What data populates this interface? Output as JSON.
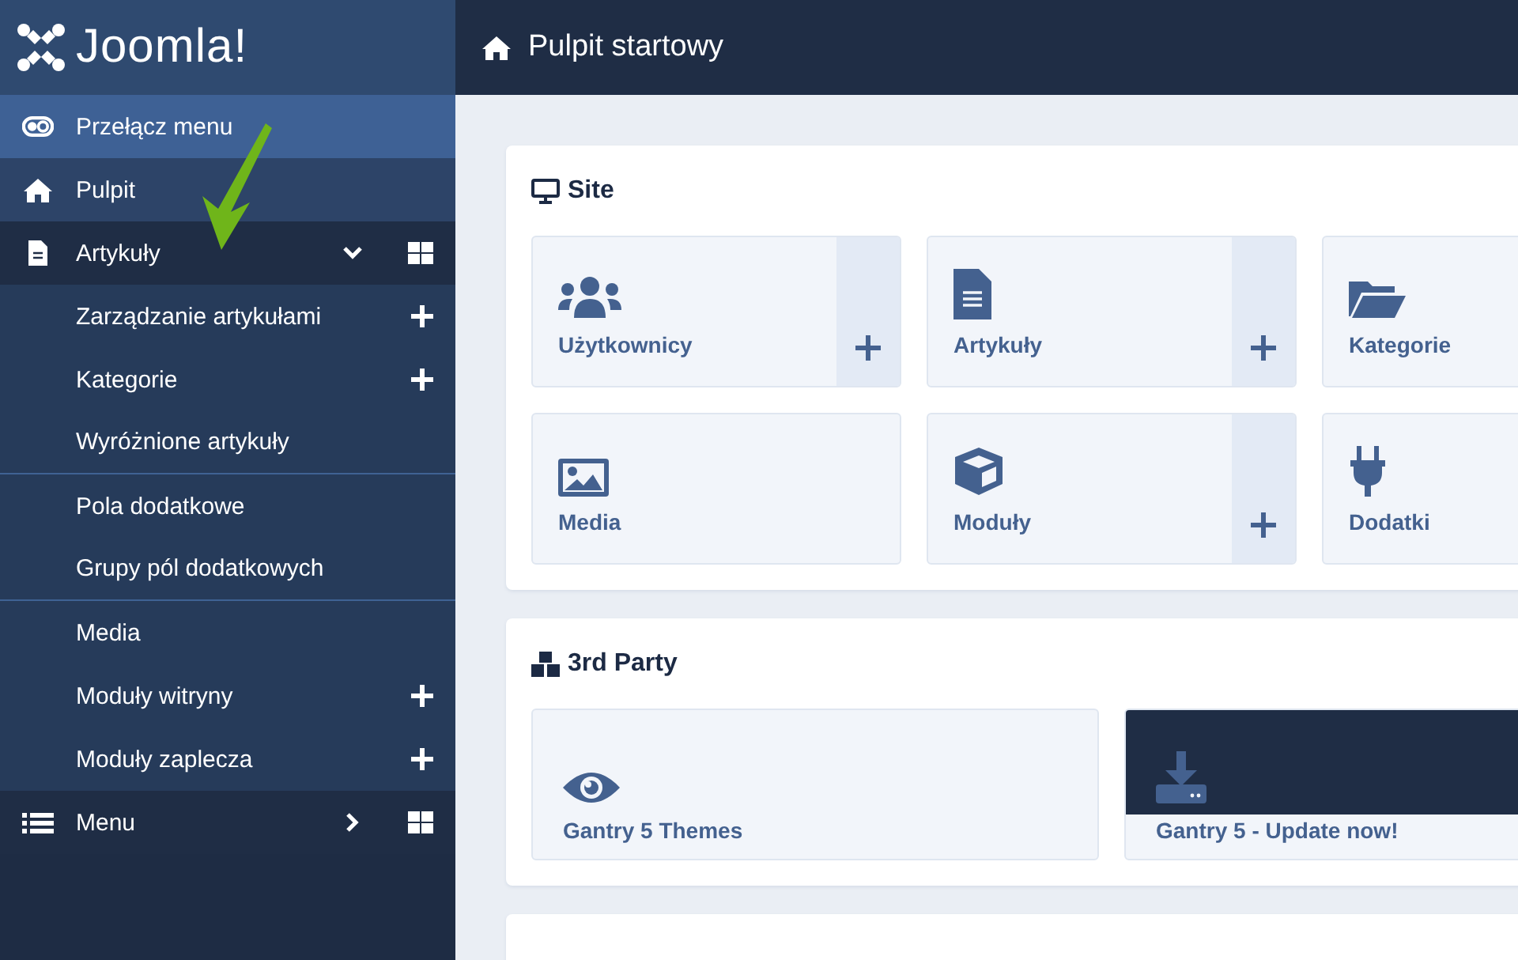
{
  "brand": {
    "name": "Joomla!"
  },
  "header": {
    "title": "Pulpit startowy"
  },
  "sidebar": {
    "items": [
      {
        "kind": "toggle",
        "label": "Przełącz menu"
      },
      {
        "kind": "link",
        "label": "Pulpit"
      },
      {
        "kind": "section",
        "label": "Artykuły",
        "expanded": true,
        "children": [
          {
            "label": "Zarządzanie artykułami",
            "add": true,
            "separator": false
          },
          {
            "label": "Kategorie",
            "add": true,
            "separator": false
          },
          {
            "label": "Wyróżnione artykuły",
            "add": false,
            "separator": true
          },
          {
            "label": "Pola dodatkowe",
            "add": false,
            "separator": false
          },
          {
            "label": "Grupy pól dodatkowych",
            "add": false,
            "separator": true
          },
          {
            "label": "Media",
            "add": false,
            "separator": false
          },
          {
            "label": "Moduły witryny",
            "add": true,
            "separator": false
          },
          {
            "label": "Moduły zaplecza",
            "add": true,
            "separator": false
          }
        ]
      },
      {
        "kind": "section",
        "label": "Menu",
        "expanded": false
      }
    ]
  },
  "panels": [
    {
      "title": "Site",
      "tiles": [
        {
          "label": "Użytkownicy",
          "add": true,
          "highlighted": false
        },
        {
          "label": "Artykuły",
          "add": true,
          "highlighted": false
        },
        {
          "label": "Kategorie",
          "highlighted": false
        },
        {
          "label": "Media",
          "add": false,
          "highlighted": false
        },
        {
          "label": "Moduły",
          "add": true,
          "highlighted": false
        },
        {
          "label": "Dodatki",
          "highlighted": false
        }
      ]
    },
    {
      "title": "3rd Party",
      "tiles": [
        {
          "label": "Gantry 5 Themes",
          "add": false,
          "highlighted": false
        },
        {
          "label": "Gantry 5 - Update now!",
          "add": false,
          "highlighted": true
        }
      ]
    }
  ]
}
